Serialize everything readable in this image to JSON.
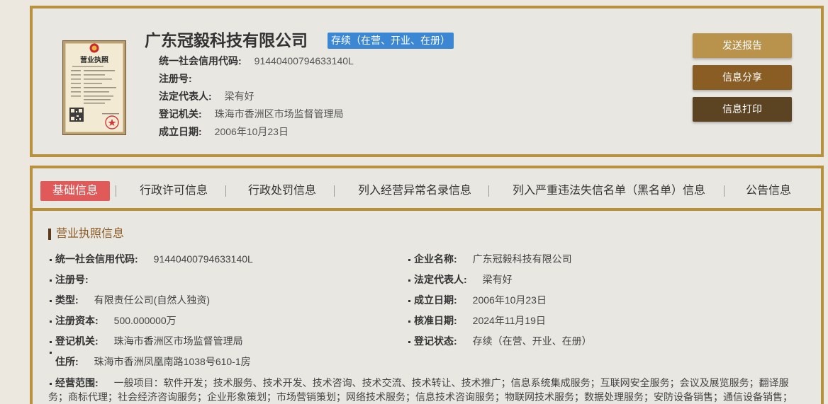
{
  "colors": {
    "page_bg": "#ece8e0",
    "card_bg": "#e8e7e2",
    "accent_gold": "#b8913e",
    "badge_blue": "#3b87d4",
    "active_tab": "#e05a5a",
    "btn_send_report": "#b9924b",
    "btn_share": "#8a5d25",
    "btn_print": "#5c4322",
    "section_title": "#8a5a22",
    "section_bar": "#5b3b1b"
  },
  "header": {
    "license_image": {
      "icon": "business-license-image",
      "title": "营业执照"
    },
    "company_name": "广东冠毅科技有限公司",
    "status_badge": "存续（在营、开业、在册）",
    "info": [
      {
        "label": "统一社会信用代码:",
        "value": "91440400794633140L"
      },
      {
        "label": "注册号:",
        "value": ""
      },
      {
        "label": "法定代表人:",
        "value": "梁有好"
      },
      {
        "label": "登记机关:",
        "value": "珠海市香洲区市场监督管理局"
      },
      {
        "label": "成立日期:",
        "value": "2006年10月23日"
      }
    ],
    "buttons": {
      "send_report": "发送报告",
      "share": "信息分享",
      "print": "信息打印"
    }
  },
  "tabs": [
    {
      "label": "基础信息",
      "active": true
    },
    {
      "label": "行政许可信息",
      "active": false
    },
    {
      "label": "行政处罚信息",
      "active": false
    },
    {
      "label": "列入经营异常名录信息",
      "active": false
    },
    {
      "label": "列入严重违法失信名单（黑名单）信息",
      "active": false
    },
    {
      "label": "公告信息",
      "active": false
    }
  ],
  "business_license": {
    "title": "营业执照信息",
    "rows": [
      {
        "left": {
          "label": "统一社会信用代码:",
          "value": "91440400794633140L"
        },
        "right": {
          "label": "企业名称:",
          "value": "广东冠毅科技有限公司"
        }
      },
      {
        "left": {
          "label": "注册号:",
          "value": ""
        },
        "right": {
          "label": "法定代表人:",
          "value": "梁有好"
        }
      },
      {
        "left": {
          "label": "类型:",
          "value": "有限责任公司(自然人独资)"
        },
        "right": {
          "label": "成立日期:",
          "value": "2006年10月23日"
        }
      },
      {
        "left": {
          "label": "注册资本:",
          "value": "500.000000万"
        },
        "right": {
          "label": "核准日期:",
          "value": "2024年11月19日"
        }
      },
      {
        "left": {
          "label": "登记机关:",
          "value": "珠海市香洲区市场监督管理局"
        },
        "right": {
          "label": "登记状态:",
          "value": "存续（在营、开业、在册）"
        }
      }
    ],
    "address": {
      "label": "住所:",
      "value": "珠海市香洲凤凰南路1038号610-1房"
    },
    "business_scope": {
      "label": "经营范围:",
      "value": "一般项目：软件开发；技术服务、技术开发、技术咨询、技术交流、技术转让、技术推广；信息系统集成服务；互联网安全服务；会议及展览服务；翻译服务；商标代理；社会经济咨询服务；企业形象策划；市场营销策划；网络技术服务；信息技术咨询服务；物联网技术服务；数据处理服务；安防设备销售；通信设备销售；"
    }
  }
}
